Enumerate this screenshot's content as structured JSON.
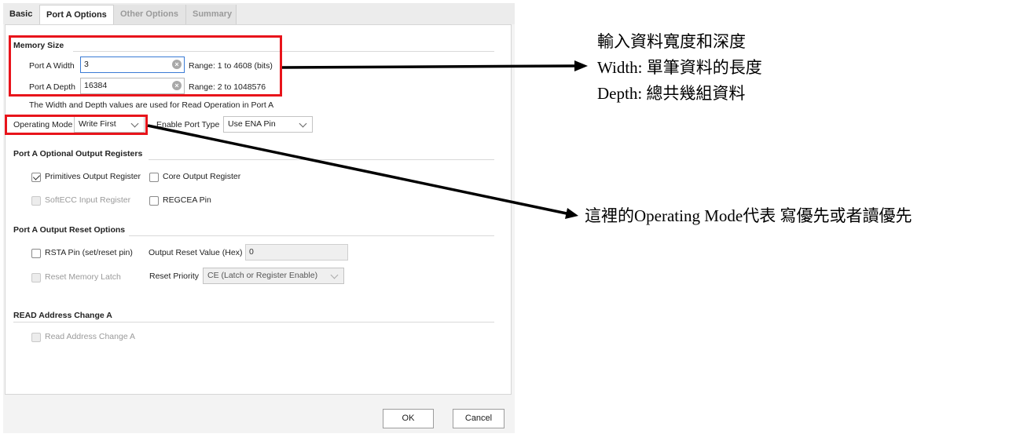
{
  "tabs": [
    "Basic",
    "Port A Options",
    "Other Options",
    "Summary"
  ],
  "memory_size": {
    "title": "Memory Size",
    "width_label": "Port A Width",
    "width_value": "3",
    "width_range": "Range: 1 to 4608 (bits)",
    "depth_label": "Port A Depth",
    "depth_value": "16384",
    "depth_range": "Range: 2 to 1048576",
    "note": "The Width and Depth values are used for Read Operation in Port A"
  },
  "operating_mode": {
    "label": "Operating Mode",
    "value": "Write First"
  },
  "enable_port_type": {
    "label": "Enable Port Type",
    "value": "Use ENA Pin"
  },
  "optional_output_registers": {
    "title": "Port A Optional Output Registers",
    "primitives_output_register": {
      "label": "Primitives Output Register",
      "checked": true
    },
    "core_output_register": {
      "label": "Core Output Register",
      "checked": false
    },
    "softecc_input_register": {
      "label": "SoftECC Input Register",
      "checked": false,
      "disabled": true
    },
    "regcea_pin": {
      "label": "REGCEA Pin",
      "checked": false
    }
  },
  "output_reset_options": {
    "title": "Port A Output Reset Options",
    "rsta_pin": {
      "label": "RSTA Pin (set/reset pin)",
      "checked": false
    },
    "output_reset_value_label": "Output Reset Value (Hex)",
    "output_reset_value": "0",
    "reset_memory_latch": {
      "label": "Reset Memory Latch",
      "checked": false,
      "disabled": true
    },
    "reset_priority_label": "Reset Priority",
    "reset_priority_value": "CE (Latch or Register Enable)"
  },
  "read_address_change": {
    "title": "READ Address Change A",
    "read_address_change_a": {
      "label": "Read Address Change A",
      "checked": false,
      "disabled": true
    }
  },
  "buttons": {
    "ok": "OK",
    "cancel": "Cancel"
  },
  "annotations": {
    "memory_note_line1": "輸入資料寬度和深度",
    "memory_note_line2": "Width: 單筆資料的長度",
    "memory_note_line3": "Depth: 總共幾組資料",
    "mode_note": "這裡的Operating Mode代表 寫優先或者讀優先"
  },
  "colors": {
    "highlight_red": "#e8141b",
    "focus_blue": "#3a7bd5"
  }
}
